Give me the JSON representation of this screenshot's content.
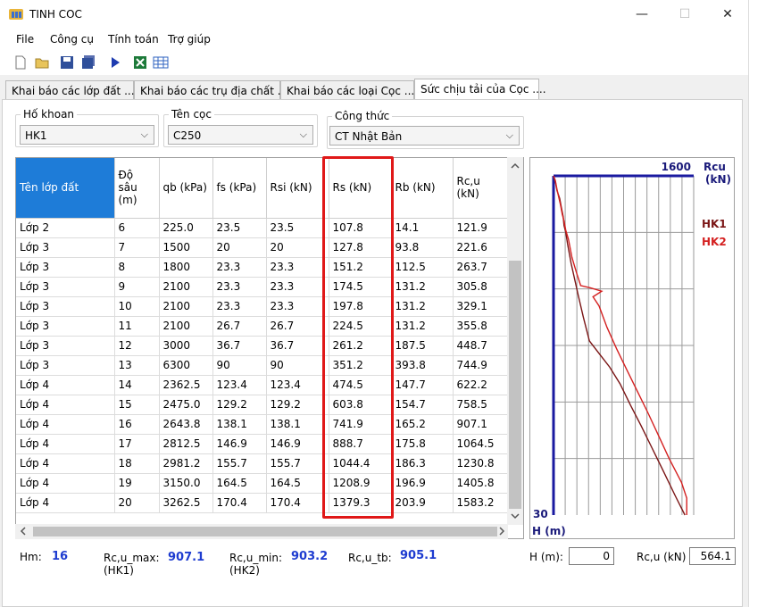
{
  "window": {
    "title": "TINH COC",
    "minimize": "—",
    "maximize": "☐",
    "close": "✕"
  },
  "menu": [
    "File",
    "Công cụ",
    "Tính toán",
    "Trợ giúp"
  ],
  "tabs": [
    {
      "label": "Khai báo các lớp đất ......"
    },
    {
      "label": "Khai báo các trụ địa chất ...."
    },
    {
      "label": "Khai báo các loại Cọc ......"
    },
    {
      "label": "Sức chịu tải của Cọc ...."
    }
  ],
  "filters": {
    "borehole": {
      "legend": "Hố khoan",
      "value": "HK1"
    },
    "pile": {
      "legend": "Tên cọc",
      "value": "C250"
    },
    "formula": {
      "legend": "Công thức",
      "value": "CT Nhật Bản"
    }
  },
  "table": {
    "headers": [
      "Tên lớp đất",
      "Độ sâu (m)",
      "qb (kPa)",
      "fs (kPa)",
      "Rsi (kN)",
      "Rs (kN)",
      "Rb (kN)",
      "Rc,u (kN)"
    ],
    "rows": [
      [
        "Lớp 2",
        "6",
        "225.0",
        "23.5",
        "23.5",
        "107.8",
        "14.1",
        "121.9"
      ],
      [
        "Lớp 3",
        "7",
        "1500",
        "20",
        "20",
        "127.8",
        "93.8",
        "221.6"
      ],
      [
        "Lớp 3",
        "8",
        "1800",
        "23.3",
        "23.3",
        "151.2",
        "112.5",
        "263.7"
      ],
      [
        "Lớp 3",
        "9",
        "2100",
        "23.3",
        "23.3",
        "174.5",
        "131.2",
        "305.8"
      ],
      [
        "Lớp 3",
        "10",
        "2100",
        "23.3",
        "23.3",
        "197.8",
        "131.2",
        "329.1"
      ],
      [
        "Lớp 3",
        "11",
        "2100",
        "26.7",
        "26.7",
        "224.5",
        "131.2",
        "355.8"
      ],
      [
        "Lớp 3",
        "12",
        "3000",
        "36.7",
        "36.7",
        "261.2",
        "187.5",
        "448.7"
      ],
      [
        "Lớp 3",
        "13",
        "6300",
        "90",
        "90",
        "351.2",
        "393.8",
        "744.9"
      ],
      [
        "Lớp 4",
        "14",
        "2362.5",
        "123.4",
        "123.4",
        "474.5",
        "147.7",
        "622.2"
      ],
      [
        "Lớp 4",
        "15",
        "2475.0",
        "129.2",
        "129.2",
        "603.8",
        "154.7",
        "758.5"
      ],
      [
        "Lớp 4",
        "16",
        "2643.8",
        "138.1",
        "138.1",
        "741.9",
        "165.2",
        "907.1"
      ],
      [
        "Lớp 4",
        "17",
        "2812.5",
        "146.9",
        "146.9",
        "888.7",
        "175.8",
        "1064.5"
      ],
      [
        "Lớp 4",
        "18",
        "2981.2",
        "155.7",
        "155.7",
        "1044.4",
        "186.3",
        "1230.8"
      ],
      [
        "Lớp 4",
        "19",
        "3150.0",
        "164.5",
        "164.5",
        "1208.9",
        "196.9",
        "1405.8"
      ],
      [
        "Lớp 4",
        "20",
        "3262.5",
        "170.4",
        "170.4",
        "1379.3",
        "203.9",
        "1583.2"
      ]
    ]
  },
  "chart": {
    "ymax_label": "1600",
    "x_title": "Rcu\n(kN)",
    "depth_max_label": "30",
    "y_title": "H (m)",
    "legend": [
      {
        "name": "HK1",
        "color": "#7a1515"
      },
      {
        "name": "HK2",
        "color": "#d42020"
      }
    ],
    "axis_color": "#1a1aa0",
    "depth_max": 30,
    "load_max": 1600,
    "hk1": [
      [
        0,
        0
      ],
      [
        0.5,
        2
      ],
      [
        1.3,
        4
      ],
      [
        2,
        7
      ],
      [
        2.8,
        9
      ],
      [
        3.6,
        11
      ],
      [
        4.4,
        12
      ],
      [
        5.0,
        14
      ],
      [
        6.0,
        16
      ],
      [
        7.7,
        20
      ],
      [
        10.5,
        28
      ],
      [
        12.5,
        34
      ],
      [
        14.6,
        41
      ],
      [
        15.7,
        52
      ],
      [
        16.9,
        64
      ],
      [
        18.4,
        76
      ],
      [
        20.3,
        88
      ],
      [
        22.1,
        100
      ],
      [
        24.0,
        112
      ],
      [
        25.9,
        124
      ],
      [
        28.3,
        139
      ],
      [
        30.0,
        150
      ]
    ],
    "hk2": [
      [
        0,
        0
      ],
      [
        0.4,
        2
      ],
      [
        1.2,
        4
      ],
      [
        1.9,
        6
      ],
      [
        2.6,
        8
      ],
      [
        3.4,
        10
      ],
      [
        4.0,
        12
      ],
      [
        4.8,
        14
      ],
      [
        5.6,
        17
      ],
      [
        7.2,
        21
      ],
      [
        8.5,
        26
      ],
      [
        9.7,
        31
      ],
      [
        9.9,
        42
      ],
      [
        10.2,
        55
      ],
      [
        10.7,
        45
      ],
      [
        11.5,
        52
      ],
      [
        13.4,
        61
      ],
      [
        15.3,
        72
      ],
      [
        17.2,
        84
      ],
      [
        19.1,
        96
      ],
      [
        21.0,
        108
      ],
      [
        23.0,
        120
      ],
      [
        25.0,
        132
      ],
      [
        27.1,
        146
      ],
      [
        28.5,
        152
      ],
      [
        30.0,
        152
      ]
    ]
  },
  "summary": {
    "hm_label": "Hm:",
    "hm_value": "16",
    "max_label": "Rc,u_max:\n(HK1)",
    "max_value": "907.1",
    "min_label": "Rc,u_min:\n(HK2)",
    "min_value": "903.2",
    "tb_label": "Rc,u_tb:",
    "tb_value": "905.1",
    "h_label": "H (m):",
    "h_value": "0",
    "rcu_label": "Rc,u (kN)",
    "rcu_value": "564.1"
  }
}
